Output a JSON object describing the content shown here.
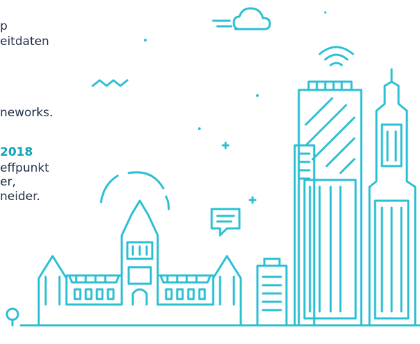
{
  "text": {
    "line1": "p",
    "line2": "eitdaten",
    "line3": "neworks.",
    "line4": "2018",
    "line5": "effpunkt",
    "line6": "er,",
    "line7": "neider."
  },
  "colors": {
    "stroke": "#2bbfd3",
    "accent": "#16a3b5",
    "text": "#1f2f45",
    "background": "#ffffff"
  },
  "icons": [
    "cloud-icon",
    "wifi-icon",
    "chat-bubble-icon",
    "tree-icon",
    "sparkle-icon"
  ]
}
